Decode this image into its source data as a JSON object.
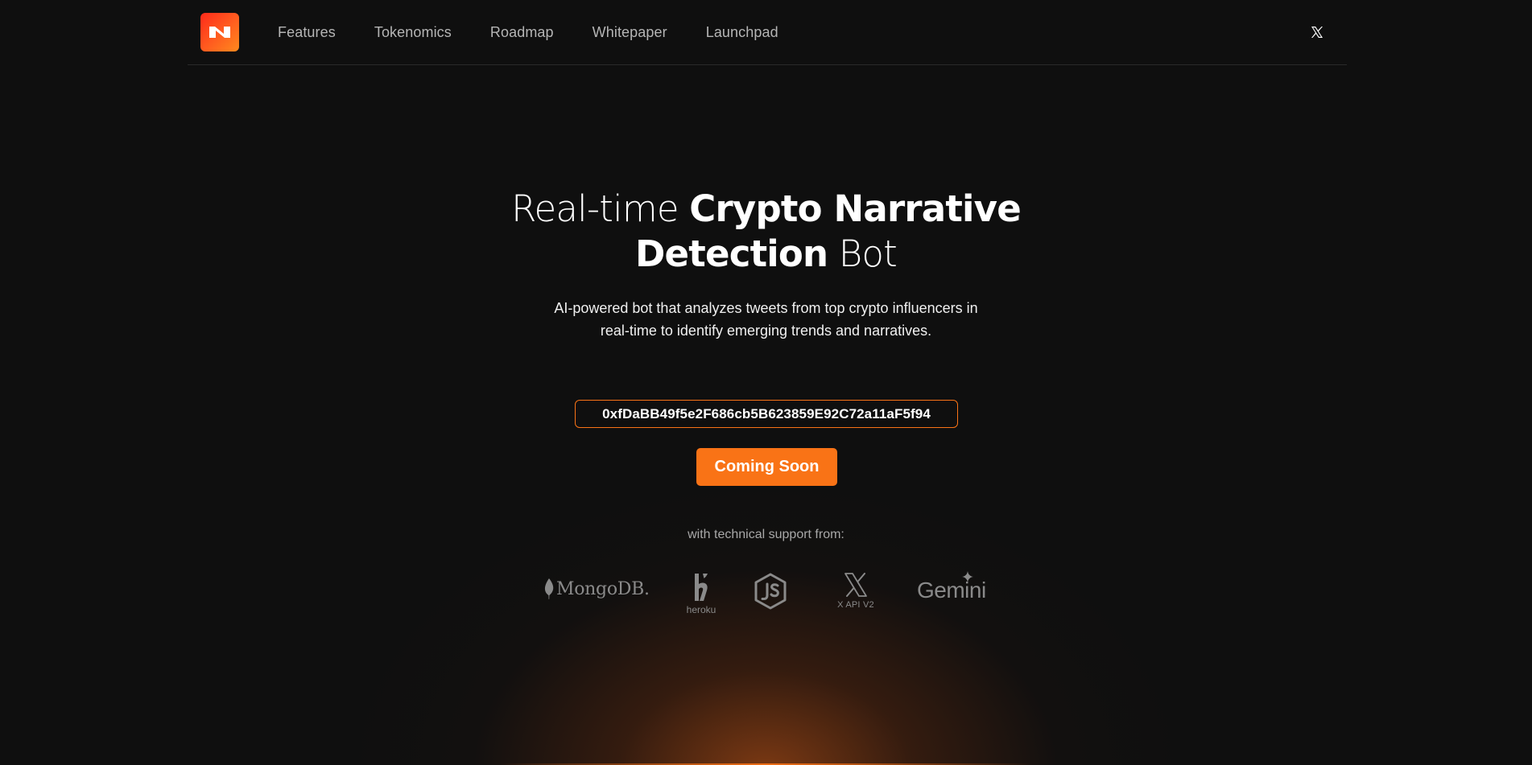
{
  "nav": {
    "items": [
      {
        "label": "Features"
      },
      {
        "label": "Tokenomics"
      },
      {
        "label": "Roadmap"
      },
      {
        "label": "Whitepaper"
      },
      {
        "label": "Launchpad"
      }
    ]
  },
  "hero": {
    "title_part1": "Real-time ",
    "title_bold1": "Crypto Narrative",
    "title_bold2": "Detection",
    "title_part2": " Bot",
    "subtitle_line1": "AI-powered bot that analyzes tweets from top crypto influencers in",
    "subtitle_line2": "real-time to identify emerging trends and narratives.",
    "contract_address": "0xfDaBB49f5e2F686cb5B623859E92C72a11aF5f94",
    "cta_label": "Coming Soon",
    "support_label": "with technical support from:"
  },
  "partners": {
    "mongodb": "MongoDB.",
    "heroku": "heroku",
    "xapi": "X API V2",
    "gemini": "Gemini"
  },
  "colors": {
    "accent": "#f97316",
    "background": "#0f0f0f",
    "logo_gradient_start": "#ff2a1a",
    "logo_gradient_end": "#ff8a1e"
  },
  "icons": {
    "logo": "n-logo-icon",
    "social": "x-icon"
  }
}
